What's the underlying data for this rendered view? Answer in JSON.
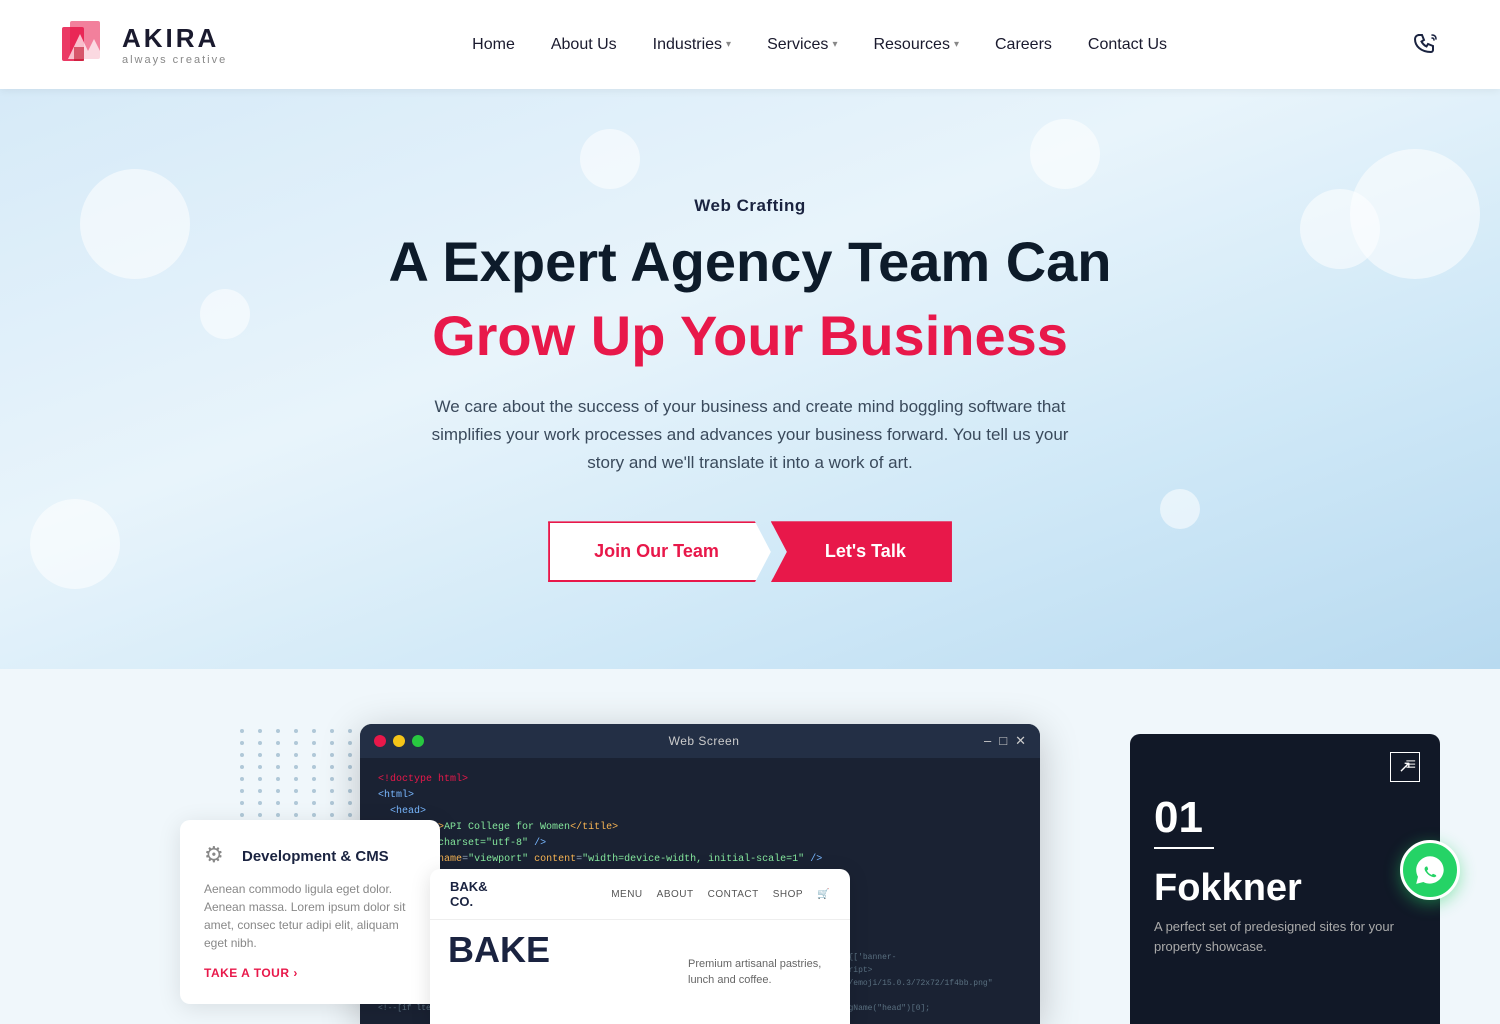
{
  "brand": {
    "name": "AKIRA",
    "tagline": "always creative",
    "logo_icon_color": "#e8184a"
  },
  "navbar": {
    "home": "Home",
    "about": "About Us",
    "industries": "Industries",
    "services": "Services",
    "resources": "Resources",
    "careers": "Careers",
    "contact": "Contact Us"
  },
  "hero": {
    "tag": "Web Crafting",
    "title_line1": "A Expert Agency Team Can",
    "title_line2": "Grow Up Your Business",
    "description": "We care about the success of your business and create mind boggling software that simplifies your work processes and advances your business forward. You tell us your story and we'll translate it into a work of art.",
    "btn_join": "Join Our Team",
    "btn_talk": "Let's Talk"
  },
  "preview": {
    "dev_card": {
      "title": "Development & CMS",
      "description": "Aenean commodo ligula eget dolor. Aenean massa. Lorem ipsum dolor sit amet, consec tetur adipi elit, aliquam eget nibh.",
      "link": "TAKE A TOUR"
    },
    "code_window": {
      "title": "Web Screen"
    },
    "bake": {
      "logo": "BAK&\nCO.",
      "nav_links": [
        "MENU",
        "ABOUT",
        "CONTACT",
        "SHOP"
      ],
      "big_text": "BAKE",
      "description": "Premium artisanal pastries, lunch and coffee."
    },
    "fokkner": {
      "number": "01",
      "title": "Fokkner",
      "description": "A perfect set of predesigned sites for your property showcase."
    }
  }
}
